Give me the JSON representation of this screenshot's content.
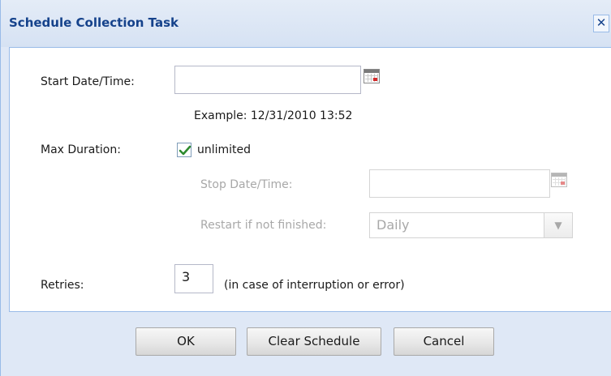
{
  "dialog": {
    "title": "Schedule Collection Task",
    "close_icon": "close-icon",
    "close_glyph": "✕"
  },
  "form": {
    "start": {
      "label": "Start Date/Time:",
      "value": "",
      "example": "Example: 12/31/2010 13:52",
      "icon": "calendar-icon"
    },
    "max_duration": {
      "label": "Max Duration:",
      "unlimited_label": "unlimited",
      "unlimited_checked": true
    },
    "stop": {
      "label": "Stop Date/Time:",
      "value": "",
      "disabled": true,
      "icon": "calendar-icon"
    },
    "restart": {
      "label": "Restart if not finished:",
      "selected": "Daily",
      "disabled": true
    },
    "retries": {
      "label": "Retries:",
      "value": "3",
      "note": "(in case of interruption or error)"
    }
  },
  "buttons": {
    "ok": "OK",
    "clear": "Clear Schedule",
    "cancel": "Cancel"
  },
  "colors": {
    "title": "#15428b",
    "frame": "#dfe8f6",
    "border": "#99bbe8",
    "disabled_text": "#a8a8a8",
    "checkmark": "#2e8b2e",
    "calendar_mark": "#d42a2a"
  }
}
